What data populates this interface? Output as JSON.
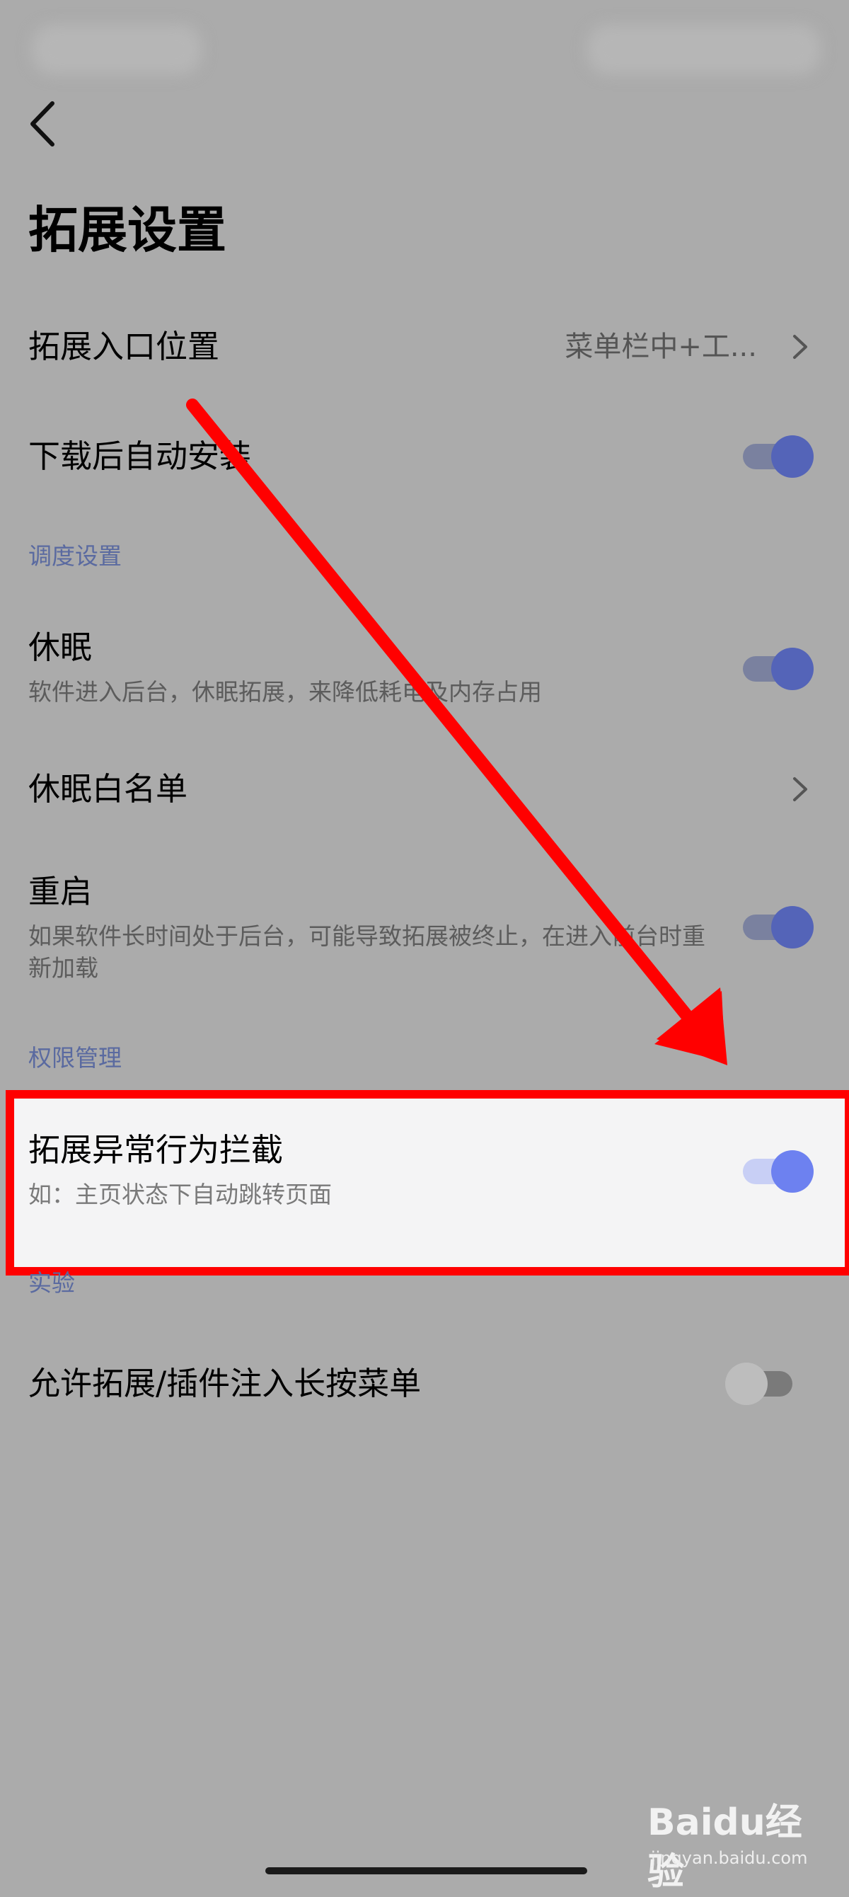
{
  "header": {
    "title": "拓展设置"
  },
  "rows": {
    "entry_position": {
      "title": "拓展入口位置",
      "value": "菜单栏中+工..."
    },
    "auto_install": {
      "title": "下载后自动安装",
      "toggle": "on"
    },
    "sleep": {
      "title": "休眠",
      "desc": "软件进入后台，休眠拓展，来降低耗电及内存占用",
      "toggle": "on"
    },
    "sleep_whitelist": {
      "title": "休眠白名单"
    },
    "restart": {
      "title": "重启",
      "desc": "如果软件长时间处于后台，可能导致拓展被终止，在进入前台时重新加载",
      "toggle": "on"
    },
    "abnormal_block": {
      "title": "拓展异常行为拦截",
      "desc": "如：主页状态下自动跳转页面",
      "toggle": "on"
    },
    "inject_menu": {
      "title": "允许拓展/插件注入长按菜单",
      "toggle": "off"
    }
  },
  "sections": {
    "scheduling": "调度设置",
    "permissions": "权限管理",
    "experimental": "实验"
  },
  "watermark": {
    "logo": "Baidu经验",
    "sub": "jingyan.baidu.com"
  },
  "colors": {
    "overlay_bg": "#ababab",
    "accent": "#5464b8",
    "highlight_border": "#ff0000",
    "arrow": "#ff0000"
  }
}
